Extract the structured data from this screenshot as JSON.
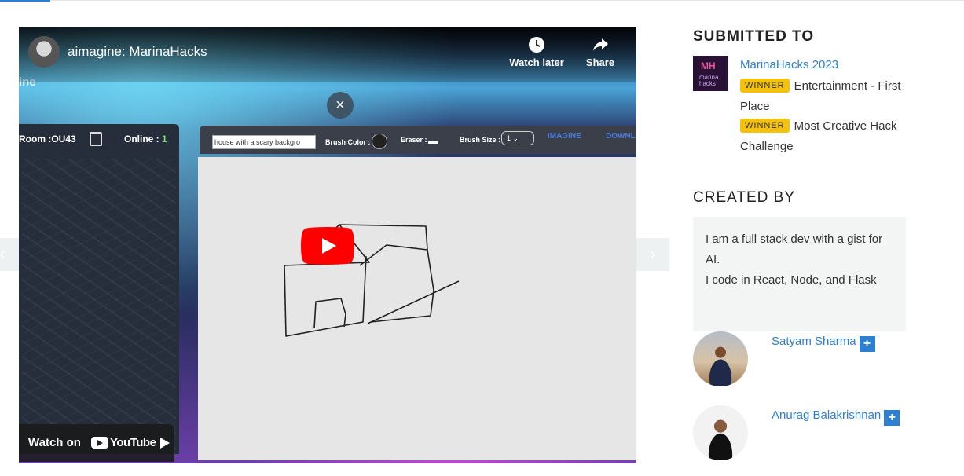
{
  "video": {
    "title": "aimagine: MarinaHacks",
    "watch_later_label": "Watch later",
    "share_label": "Share",
    "watch_on_label": "Watch on",
    "youtube_wordmark": "YouTube",
    "icons": {
      "channel": "channel-avatar",
      "watch_later": "clock-icon",
      "share": "share-arrow-icon",
      "close": "close-icon",
      "play": "play-icon",
      "next": "next-icon"
    },
    "app": {
      "logo_text": "ine",
      "room_label": "Room :OU43",
      "online_label": "Online :",
      "online_count": "1",
      "prompt_value": "house with a scary backgro",
      "brush_color_label": "Brush Color :",
      "eraser_label": "Eraser :",
      "brush_size_label": "Brush Size :",
      "brush_size_value": "1",
      "imagine_label": "IMAGINE",
      "download_label": "DOWNL"
    }
  },
  "sidebar": {
    "submitted_heading": "SUBMITTED TO",
    "hackathon": {
      "name": "MarinaHacks 2023",
      "thumb_line1": "MH",
      "thumb_line2": "marina hacks"
    },
    "prizes": [
      {
        "badge": "WINNER",
        "text": "Entertainment - First Place"
      },
      {
        "badge": "WINNER",
        "text": "Most Creative Hack Challenge"
      }
    ],
    "created_heading": "CREATED BY",
    "bio": {
      "line1": "I am a full stack dev with a gist for AI.",
      "line2": "I code in React, Node, and Flask"
    },
    "members": [
      {
        "name": "Satyam Sharma",
        "plus": "+"
      },
      {
        "name": "Anurag Balakrishnan",
        "plus": "+"
      }
    ]
  },
  "colors": {
    "link": "#2d7fd1",
    "badge": "#f4c20d",
    "youtube_red": "#ff0000"
  }
}
